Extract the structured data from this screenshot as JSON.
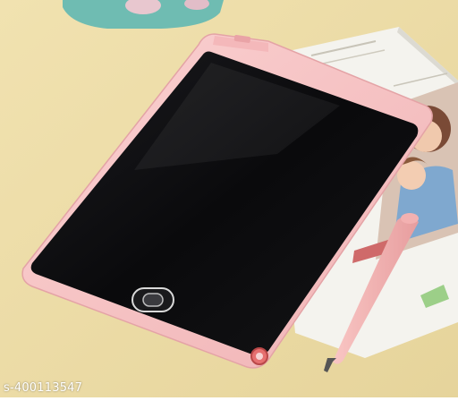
{
  "scene": {
    "colors": {
      "background": "#ecdca6",
      "tray": "#6fbcb2",
      "tablet_frame": "#f7c4c4",
      "screen": "#0d0d0f",
      "booklet": "#f4f3ee",
      "stylus": "#f6b8b6"
    },
    "icons": [
      "stylus",
      "lock-switch-icon",
      "erase-button-icon"
    ]
  },
  "watermark": {
    "text": "s-400113547"
  }
}
